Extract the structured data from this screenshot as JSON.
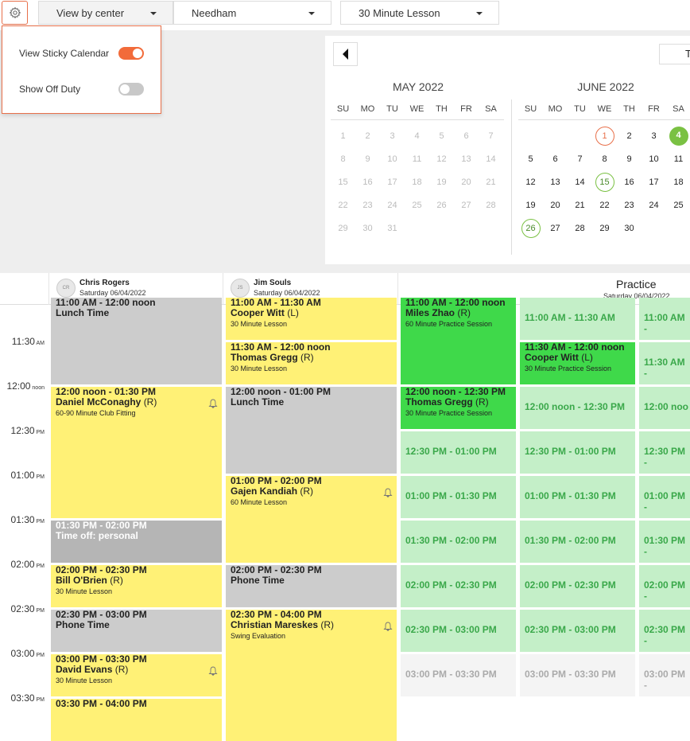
{
  "toolbar": {
    "view_select": "View by center",
    "location_select": "Needham",
    "lesson_select": "30 Minute Lesson"
  },
  "settings": {
    "sticky_calendar_label": "View Sticky Calendar",
    "sticky_calendar_on": true,
    "off_duty_label": "Show Off Duty",
    "off_duty_on": false
  },
  "colors": {
    "accent": "#f26b3a",
    "green": "#7ac143",
    "today_ring": "#e8704a"
  },
  "calendar": {
    "today_button": "T",
    "weekdays": [
      "SU",
      "MO",
      "TU",
      "WE",
      "TH",
      "FR",
      "SA"
    ],
    "may": {
      "title": "MAY 2022",
      "weeks": [
        [
          "1",
          "2",
          "3",
          "4",
          "5",
          "6",
          "7"
        ],
        [
          "8",
          "9",
          "10",
          "11",
          "12",
          "13",
          "14"
        ],
        [
          "15",
          "16",
          "17",
          "18",
          "19",
          "20",
          "21"
        ],
        [
          "22",
          "23",
          "24",
          "25",
          "26",
          "27",
          "28"
        ],
        [
          "29",
          "30",
          "31",
          "",
          "",
          "",
          ""
        ]
      ]
    },
    "june": {
      "title": "JUNE 2022",
      "weeks": [
        [
          "",
          "",
          "",
          "1",
          "2",
          "3",
          "4"
        ],
        [
          "5",
          "6",
          "7",
          "8",
          "9",
          "10",
          "11"
        ],
        [
          "12",
          "13",
          "14",
          "15",
          "16",
          "17",
          "18"
        ],
        [
          "19",
          "20",
          "21",
          "22",
          "23",
          "24",
          "25"
        ],
        [
          "26",
          "27",
          "28",
          "29",
          "30",
          "",
          ""
        ]
      ]
    }
  },
  "schedule": {
    "resources": [
      {
        "initials": "CR",
        "name": "Chris Rogers",
        "date": "Saturday 06/04/2022"
      },
      {
        "initials": "JS",
        "name": "Jim Souls",
        "date": "Saturday 06/04/2022"
      }
    ],
    "practice": {
      "name": "Practice",
      "date": "Saturday 06/04/2022"
    },
    "times": [
      {
        "t": "11:30",
        "ap": "AM"
      },
      {
        "t": "12:00",
        "ap": "noon"
      },
      {
        "t": "12:30",
        "ap": "PM"
      },
      {
        "t": "01:00",
        "ap": "PM"
      },
      {
        "t": "01:30",
        "ap": "PM"
      },
      {
        "t": "02:00",
        "ap": "PM"
      },
      {
        "t": "02:30",
        "ap": "PM"
      },
      {
        "t": "03:00",
        "ap": "PM"
      },
      {
        "t": "03:30",
        "ap": "PM"
      }
    ],
    "col1": [
      {
        "time": "11:00 AM - 12:00 noon",
        "name": "Lunch Time",
        "tag": "",
        "sub": ""
      },
      {
        "time": "12:00 noon - 01:30 PM",
        "name": "Daniel McConaghy",
        "tag": "(R)",
        "sub": "60-90 Minute Club Fitting"
      },
      {
        "time": "01:30 PM - 02:00 PM",
        "name": "Time off: personal",
        "tag": "",
        "sub": ""
      },
      {
        "time": "02:00 PM - 02:30 PM",
        "name": "Bill O'Brien",
        "tag": "(R)",
        "sub": "30 Minute Lesson"
      },
      {
        "time": "02:30 PM - 03:00 PM",
        "name": "Phone Time",
        "tag": "",
        "sub": ""
      },
      {
        "time": "03:00 PM - 03:30 PM",
        "name": "David Evans",
        "tag": "(R)",
        "sub": "30 Minute Lesson"
      },
      {
        "time": "03:30 PM - 04:00 PM",
        "name": "",
        "tag": "",
        "sub": ""
      }
    ],
    "col2": [
      {
        "time": "11:00 AM - 11:30 AM",
        "name": "Cooper Witt",
        "tag": "(L)",
        "sub": "30 Minute Lesson"
      },
      {
        "time": "11:30 AM - 12:00 noon",
        "name": "Thomas Gregg",
        "tag": "(R)",
        "sub": "30 Minute Lesson"
      },
      {
        "time": "12:00 noon - 01:00 PM",
        "name": "Lunch Time",
        "tag": "",
        "sub": ""
      },
      {
        "time": "01:00 PM - 02:00 PM",
        "name": "Gajen Kandiah",
        "tag": "(R)",
        "sub": "60 Minute Lesson"
      },
      {
        "time": "02:00 PM - 02:30 PM",
        "name": "Phone Time",
        "tag": "",
        "sub": ""
      },
      {
        "time": "02:30 PM - 04:00 PM",
        "name": "Christian Mareskes",
        "tag": "(R)",
        "sub": "Swing Evaluation"
      }
    ],
    "col3": [
      {
        "time": "11:00 AM - 12:00 noon",
        "name": "Miles Zhao",
        "tag": "(R)",
        "sub": "60 Minute Practice Session"
      },
      {
        "time": "12:00 noon - 12:30 PM",
        "name": "Thomas Gregg",
        "tag": "(R)",
        "sub": "30 Minute Practice Session"
      },
      {
        "time": "12:30 PM - 01:00 PM"
      },
      {
        "time": "01:00 PM - 01:30 PM"
      },
      {
        "time": "01:30 PM - 02:00 PM"
      },
      {
        "time": "02:00 PM - 02:30 PM"
      },
      {
        "time": "02:30 PM - 03:00 PM"
      },
      {
        "time": "03:00 PM - 03:30 PM"
      }
    ],
    "col4": [
      {
        "time": "11:00 AM - 11:30 AM"
      },
      {
        "time": "11:30 AM - 12:00 noon",
        "name": "Cooper Witt",
        "tag": "(L)",
        "sub": "30 Minute Practice Session"
      },
      {
        "time": "12:00 noon - 12:30 PM"
      },
      {
        "time": "12:30 PM - 01:00 PM"
      },
      {
        "time": "01:00 PM - 01:30 PM"
      },
      {
        "time": "01:30 PM - 02:00 PM"
      },
      {
        "time": "02:00 PM - 02:30 PM"
      },
      {
        "time": "02:30 PM - 03:00 PM"
      },
      {
        "time": "03:00 PM - 03:30 PM"
      }
    ],
    "col5": [
      {
        "time": "11:00 AM -"
      },
      {
        "time": "11:30 AM -"
      },
      {
        "time": "12:00 noo"
      },
      {
        "time": "12:30 PM -"
      },
      {
        "time": "01:00 PM -"
      },
      {
        "time": "01:30 PM -"
      },
      {
        "time": "02:00 PM -"
      },
      {
        "time": "02:30 PM -"
      },
      {
        "time": "03:00 PM -"
      }
    ]
  }
}
